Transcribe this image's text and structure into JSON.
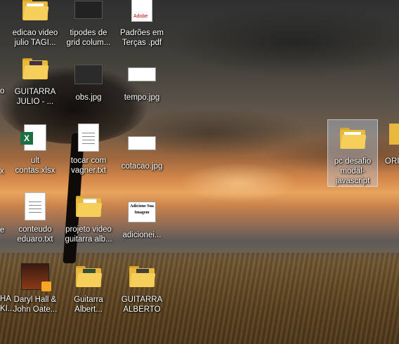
{
  "desktop": {
    "icons": [
      {
        "label": "edicao video julio TAGI...",
        "type": "folder"
      },
      {
        "label": "tipodes de grid colum...",
        "type": "image-dark"
      },
      {
        "label": "Padrões em Terças .pdf",
        "type": "pdf",
        "badge": "Adobe"
      },
      {
        "label": "GUITARRA JULIO - ...",
        "type": "folder-photo"
      },
      {
        "label": "obs.jpg",
        "type": "image-dark"
      },
      {
        "label": "tempo.jpg",
        "type": "image-light"
      },
      {
        "label": "ult contas.xlsx",
        "type": "xlsx"
      },
      {
        "label": "tocar com vagner.txt",
        "type": "text"
      },
      {
        "label": "cotacao.jpg",
        "type": "image-light"
      },
      {
        "label": "conteudo eduaro.txt",
        "type": "text"
      },
      {
        "label": "projeto video guitarra alb...",
        "type": "folder-doc"
      },
      {
        "label": "adicionei...",
        "type": "image-text",
        "thumb_text": "Adicione Sua Imagem"
      },
      {
        "label": "Daryl Hall & John Oate...",
        "type": "video"
      },
      {
        "label": "Guitarra Albert...",
        "type": "folder-photo"
      },
      {
        "label": "GUITARRA ALBERTO",
        "type": "folder-photo"
      },
      {
        "label": "pc desafio modal-javascript",
        "type": "folder",
        "selected": true
      }
    ],
    "edge_left": [
      "o",
      "x",
      "e",
      "HA",
      "KI..."
    ],
    "edge_right": "ORI",
    "pdf_badge": "Adobe",
    "xlsx_letter": "X",
    "image_text_thumb": "Adicione Sua Imagem"
  }
}
